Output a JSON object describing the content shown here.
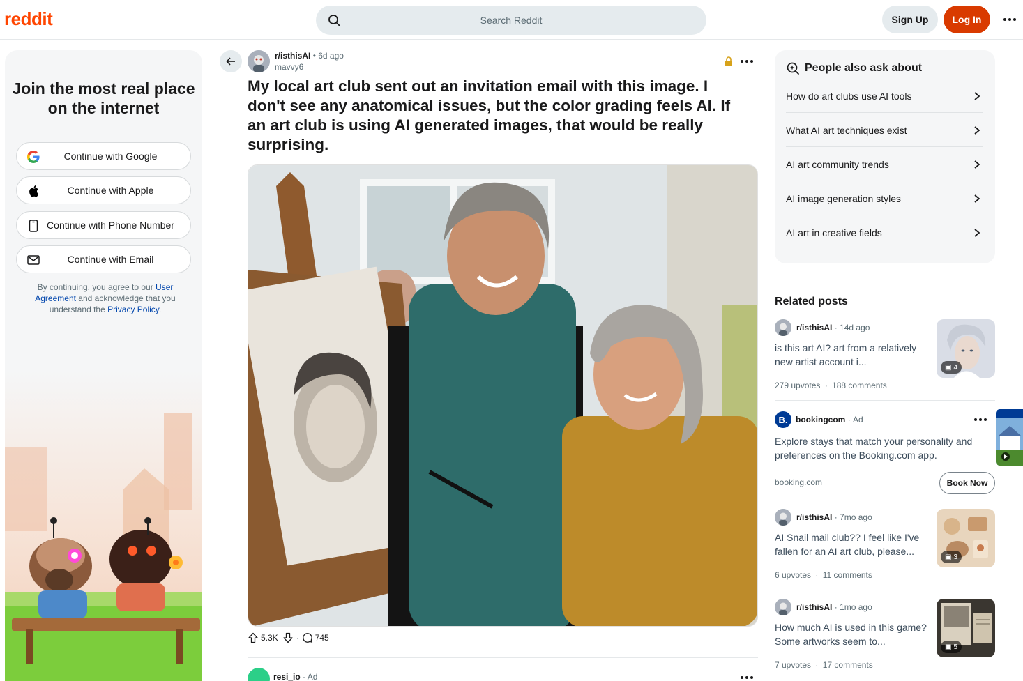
{
  "header": {
    "logo": "reddit",
    "search_placeholder": "Search Reddit",
    "signup_label": "Sign Up",
    "login_label": "Log In"
  },
  "auth": {
    "heading": "Join the most real place on the internet",
    "buttons": [
      {
        "label": "Continue with Google",
        "icon": "google-icon"
      },
      {
        "label": "Continue with Apple",
        "icon": "apple-icon"
      },
      {
        "label": "Continue with Phone Number",
        "icon": "phone-icon"
      },
      {
        "label": "Continue with Email",
        "icon": "email-icon"
      }
    ],
    "terms_prefix": "By continuing, you agree to our ",
    "terms_link1": "User Agreement",
    "terms_mid": " and acknowledge that you understand the ",
    "terms_link2": "Privacy Policy",
    "terms_suffix": "."
  },
  "post": {
    "subreddit": "r/isthisAI",
    "time": "6d ago",
    "separator": "•",
    "author": "mavvy6",
    "title": "My local art club sent out an invitation email with this image. I don't see any anatomical issues, but the color grading feels AI. If an art club is using AI generated images, that would be really surprising.",
    "upvotes": "5.3K",
    "comments": "745",
    "dot": "·"
  },
  "next_ad": {
    "name": "resi_io",
    "label": "Ad"
  },
  "people_also_ask": {
    "title": "People also ask about",
    "items": [
      "How do art clubs use AI tools",
      "What AI art techniques exist",
      "AI art community trends",
      "AI image generation styles",
      "AI art in creative fields"
    ]
  },
  "related": {
    "title": "Related posts",
    "posts": [
      {
        "subreddit": "r/isthisAI",
        "time": "14d ago",
        "title": "is this art AI? art from a relatively new artist account i...",
        "upvotes": "279 upvotes",
        "comments": "188 comments",
        "gallery_count": "4"
      },
      {
        "subreddit": "r/isthisAI",
        "time": "7mo ago",
        "title": "AI Snail mail club?? I feel like I've fallen for an AI art club, please...",
        "upvotes": "6 upvotes",
        "comments": "11 comments",
        "gallery_count": "3"
      },
      {
        "subreddit": "r/isthisAI",
        "time": "1mo ago",
        "title": "How much AI is used in this game? Some artworks seem to...",
        "upvotes": "7 upvotes",
        "comments": "17 comments",
        "gallery_count": "5"
      }
    ],
    "ad": {
      "logo_letter": "B.",
      "name": "bookingcom",
      "label": "Ad",
      "text": "Explore stays that match your personality and preferences on the Booking.com app.",
      "domain": "booking.com",
      "cta": "Book Now"
    }
  },
  "colors": {
    "brand": "#ff4500",
    "login_bg": "#d93a00",
    "link": "#0045ac",
    "booking_blue": "#003b95"
  }
}
